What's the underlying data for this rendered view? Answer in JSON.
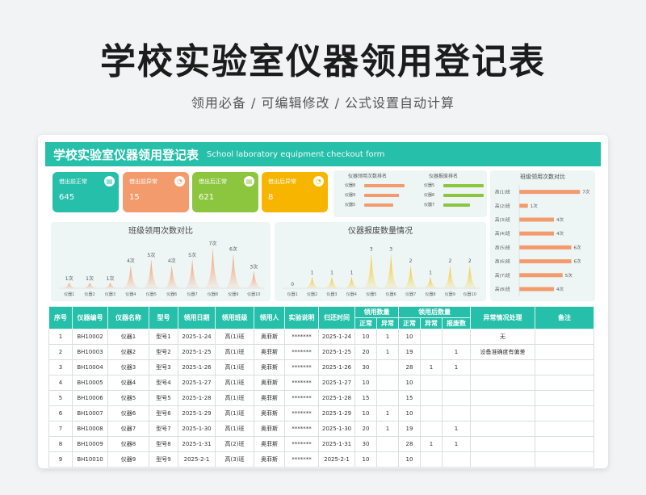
{
  "hero": {
    "title": "学校实验室仪器领用登记表",
    "subtitle": "领用必备 /  可编辑修改  / 公式设置自动计算"
  },
  "banner": {
    "title_cn": "学校实验室仪器领用登记表",
    "title_en": "School laboratory equipment checkout form"
  },
  "kpis": [
    {
      "label": "借出前正常",
      "value": "645",
      "color": "#26bfaa",
      "icon": "clipboard-icon"
    },
    {
      "label": "借出前异常",
      "value": "15",
      "color": "#f39b6d",
      "icon": "clock-icon"
    },
    {
      "label": "借出后正常",
      "value": "621",
      "color": "#8cc63f",
      "icon": "clipboard-icon"
    },
    {
      "label": "借出后异常",
      "value": "8",
      "color": "#f7b500",
      "icon": "clock-icon"
    }
  ],
  "rank_lists": [
    {
      "title": "仪器领用次数排名",
      "color": "#f39b6d",
      "items": [
        {
          "label": "仪器8",
          "value": 7
        },
        {
          "label": "仪器9",
          "value": 6
        },
        {
          "label": "仪器5",
          "value": 5
        }
      ]
    },
    {
      "title": "仪器报废排名",
      "color": "#8cc63f",
      "items": [
        {
          "label": "仪器5",
          "value": 3
        },
        {
          "label": "仪器6",
          "value": 3
        },
        {
          "label": "仪器7",
          "value": 2
        }
      ]
    }
  ],
  "chart_data": [
    {
      "type": "area",
      "title": "班级领用次数对比",
      "categories": [
        "仪器1",
        "仪器2",
        "仪器3",
        "仪器4",
        "仪器5",
        "仪器6",
        "仪器7",
        "仪器8",
        "仪器9",
        "仪器10"
      ],
      "values": [
        1,
        1,
        1,
        4,
        5,
        4,
        5,
        7,
        6,
        3
      ],
      "labels": [
        "1次",
        "1次",
        "1次",
        "4次",
        "5次",
        "4次",
        "5次",
        "7次",
        "6次",
        "3次"
      ],
      "ylim": [
        0,
        8
      ],
      "color": "#f39b6d"
    },
    {
      "type": "area",
      "title": "仪器报废数量情况",
      "categories": [
        "仪器1",
        "仪器2",
        "仪器3",
        "仪器4",
        "仪器5",
        "仪器6",
        "仪器7",
        "仪器8",
        "仪器9",
        "仪器10"
      ],
      "values": [
        0,
        1,
        1,
        1,
        3,
        3,
        2,
        1,
        2,
        2
      ],
      "labels": [
        "0",
        "1",
        "1",
        "1",
        "3",
        "3",
        "2",
        "1",
        "2",
        "2"
      ],
      "ylim": [
        0,
        4
      ],
      "color": "#f7c31a"
    },
    {
      "type": "bar",
      "orientation": "horizontal",
      "title": "班级领用次数对比",
      "categories": [
        "高(1)班",
        "高(2)班",
        "高(3)班",
        "高(4)班",
        "高(5)班",
        "高(6)班",
        "高(7)班",
        "高(8)班"
      ],
      "values": [
        7,
        1,
        4,
        4,
        6,
        6,
        5,
        4
      ],
      "labels": [
        "7次",
        "1次",
        "4次",
        "4次",
        "6次",
        "6次",
        "5次",
        "4次"
      ],
      "xlim": [
        0,
        8
      ],
      "color": "#f39b6d"
    }
  ],
  "table": {
    "headers": [
      "序号",
      "仪器编号",
      "仪器名称",
      "型号",
      "领用日期",
      "领用班级",
      "领用人",
      "实验说明",
      "归还时间",
      "领用数量",
      "领用后数量",
      "异常情况处理",
      "备注"
    ],
    "sub_headers": [
      "正常",
      "异常",
      "正常",
      "异常",
      "报废数"
    ],
    "rows": [
      [
        "1",
        "BH10002",
        "仪器1",
        "型号1",
        "2025-1-24",
        "高(1)班",
        "奥菲斯",
        "*******",
        "2025-1-24",
        "10",
        "1",
        "10",
        "",
        "",
        "无",
        ""
      ],
      [
        "2",
        "BH10003",
        "仪器2",
        "型号2",
        "2025-1-25",
        "高(1)班",
        "奥菲斯",
        "*******",
        "2025-1-25",
        "20",
        "1",
        "19",
        "",
        "1",
        "设备准确度有偏差",
        ""
      ],
      [
        "3",
        "BH10004",
        "仪器3",
        "型号3",
        "2025-1-26",
        "高(1)班",
        "奥菲斯",
        "*******",
        "2025-1-26",
        "30",
        "",
        "28",
        "1",
        "1",
        "",
        ""
      ],
      [
        "4",
        "BH10005",
        "仪器4",
        "型号4",
        "2025-1-27",
        "高(1)班",
        "奥菲斯",
        "*******",
        "2025-1-27",
        "10",
        "",
        "10",
        "",
        "",
        "",
        ""
      ],
      [
        "5",
        "BH10006",
        "仪器5",
        "型号5",
        "2025-1-28",
        "高(1)班",
        "奥菲斯",
        "*******",
        "2025-1-28",
        "15",
        "",
        "15",
        "",
        "",
        "",
        ""
      ],
      [
        "6",
        "BH10007",
        "仪器6",
        "型号6",
        "2025-1-29",
        "高(1)班",
        "奥菲斯",
        "*******",
        "2025-1-29",
        "10",
        "1",
        "10",
        "",
        "",
        "",
        ""
      ],
      [
        "7",
        "BH10008",
        "仪器7",
        "型号7",
        "2025-1-30",
        "高(1)班",
        "奥菲斯",
        "*******",
        "2025-1-30",
        "20",
        "1",
        "19",
        "",
        "1",
        "",
        ""
      ],
      [
        "8",
        "BH10009",
        "仪器8",
        "型号8",
        "2025-1-31",
        "高(2)班",
        "奥菲斯",
        "*******",
        "2025-1-31",
        "30",
        "",
        "28",
        "1",
        "1",
        "",
        ""
      ],
      [
        "9",
        "BH10010",
        "仪器9",
        "型号9",
        "2025-2-1",
        "高(3)班",
        "奥菲斯",
        "*******",
        "2025-2-1",
        "10",
        "",
        "10",
        "",
        "",
        "",
        ""
      ]
    ]
  }
}
